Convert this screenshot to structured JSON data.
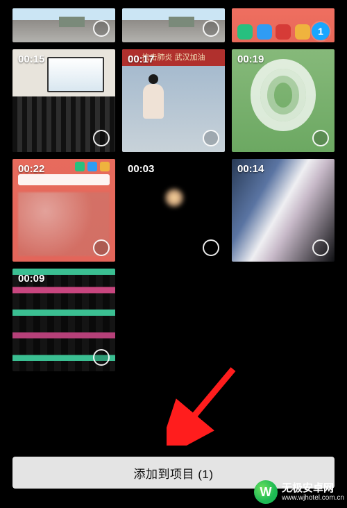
{
  "grid": {
    "items": [
      {
        "duration": null,
        "selected": false,
        "thumb_class": "p1"
      },
      {
        "duration": null,
        "selected": false,
        "thumb_class": "p2"
      },
      {
        "duration": null,
        "selected": true,
        "thumb_class": "p3",
        "badge": "1"
      },
      {
        "duration": "00:15",
        "selected": false,
        "thumb_class": "p4"
      },
      {
        "duration": "00:17",
        "selected": false,
        "thumb_class": "p5",
        "banner_text": "抗击肺炎 武汉加油"
      },
      {
        "duration": "00:19",
        "selected": false,
        "thumb_class": "p6"
      },
      {
        "duration": "00:22",
        "selected": false,
        "thumb_class": "p7"
      },
      {
        "duration": "00:03",
        "selected": false,
        "thumb_class": "p8"
      },
      {
        "duration": "00:14",
        "selected": false,
        "thumb_class": "p9"
      },
      {
        "duration": "00:09",
        "selected": false,
        "thumb_class": "p10"
      },
      {
        "duration": null,
        "selected": false,
        "thumb_class": "p11",
        "empty": true
      },
      {
        "duration": null,
        "selected": false,
        "thumb_class": "p12",
        "empty": true
      }
    ]
  },
  "action": {
    "add_button_label": "添加到项目 (1)"
  },
  "watermark": {
    "title": "无极安卓网",
    "url": "www.wjhotel.com.cn"
  },
  "colors": {
    "accent": "#1aa6ff",
    "arrow": "#ff1d1d"
  }
}
